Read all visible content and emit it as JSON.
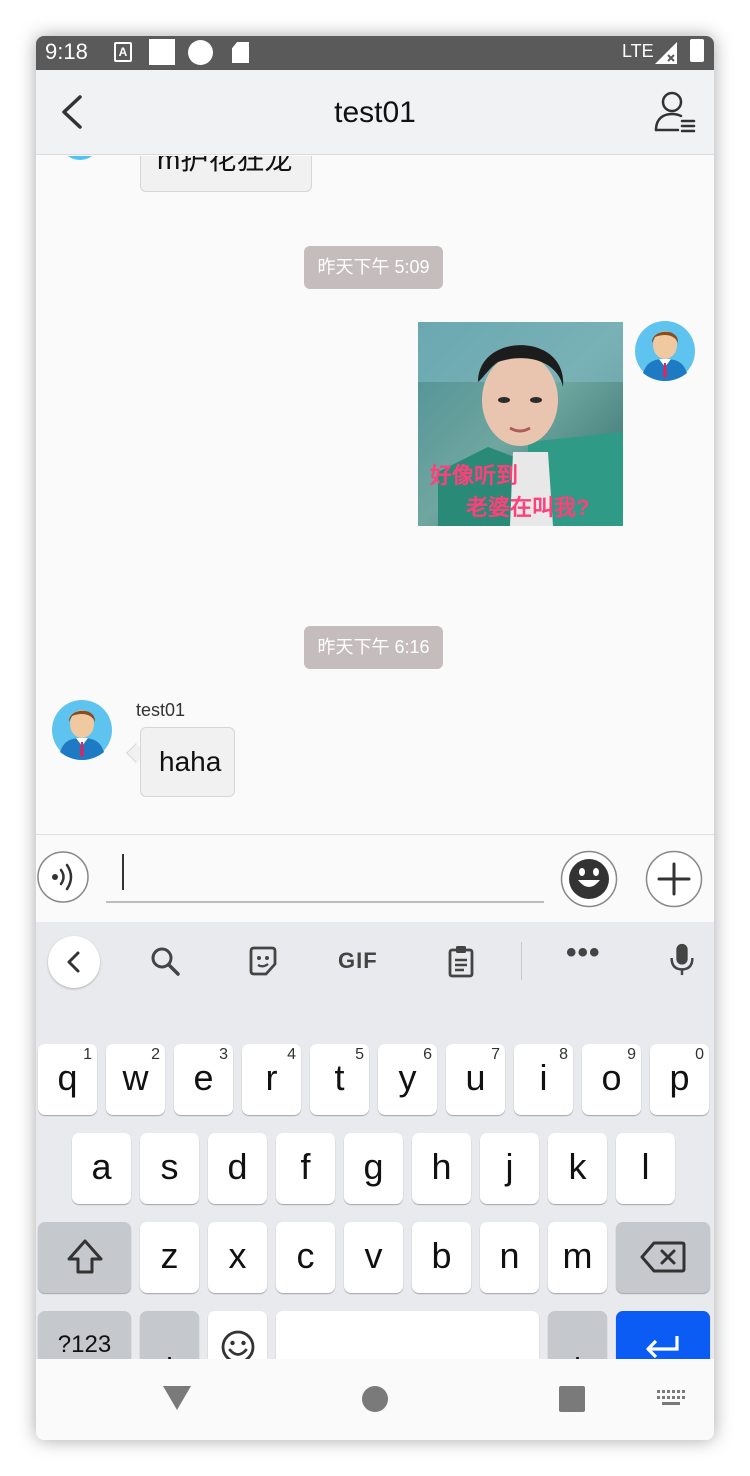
{
  "status_bar": {
    "time": "9:18",
    "network": "LTE",
    "icons": [
      "a-box-icon",
      "square-icon",
      "p-circle-icon",
      "sd-card-icon",
      "signal-icon",
      "battery-icon"
    ]
  },
  "header": {
    "title": "test01",
    "back_icon": "chevron-left-icon",
    "profile_icon": "person-menu-icon"
  },
  "chat": {
    "partial_message": "m护花狂龙",
    "time_1": "昨天下午 5:09",
    "sticker_caption_1": "好像听到",
    "sticker_caption_2": "老婆在叫我?",
    "time_2": "昨天下午 6:16",
    "sender": "test01",
    "message": "haha"
  },
  "input": {
    "voice_icon": "voice-icon",
    "emoji_icon": "emoji-icon",
    "plus_icon": "plus-icon"
  },
  "keyboard": {
    "toolbar": {
      "gif_label": "GIF",
      "more_label": "•••"
    },
    "row1": [
      {
        "k": "q",
        "n": "1"
      },
      {
        "k": "w",
        "n": "2"
      },
      {
        "k": "e",
        "n": "3"
      },
      {
        "k": "r",
        "n": "4"
      },
      {
        "k": "t",
        "n": "5"
      },
      {
        "k": "y",
        "n": "6"
      },
      {
        "k": "u",
        "n": "7"
      },
      {
        "k": "i",
        "n": "8"
      },
      {
        "k": "o",
        "n": "9"
      },
      {
        "k": "p",
        "n": "0"
      }
    ],
    "row2": [
      "a",
      "s",
      "d",
      "f",
      "g",
      "h",
      "j",
      "k",
      "l"
    ],
    "row3": [
      "z",
      "x",
      "c",
      "v",
      "b",
      "n",
      "m"
    ],
    "symbols_label": "?123",
    "comma_label": ",",
    "period_label": "."
  },
  "colors": {
    "enter_key": "#0b5cf5",
    "time_chip": "#c5bdbd",
    "status_bar": "#5a5a5a"
  }
}
